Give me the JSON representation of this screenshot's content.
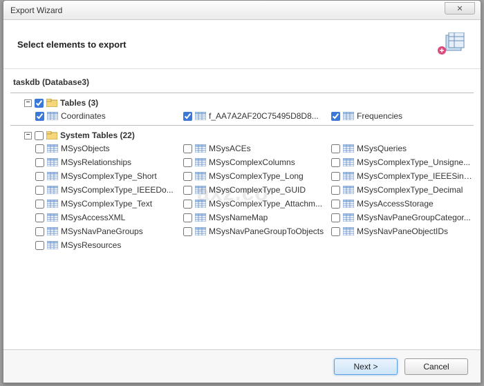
{
  "window": {
    "title": "Export Wizard",
    "close_glyph": "✕"
  },
  "header": {
    "title": "Select elements to export"
  },
  "database": {
    "label": "taskdb (Database3)"
  },
  "tables_group": {
    "toggle": "−",
    "label": "Tables (3)"
  },
  "tables": [
    {
      "label": "Coordinates",
      "checked": true
    },
    {
      "label": "f_AA7A2AF20C75495D8D8...",
      "checked": true
    },
    {
      "label": "Frequencies",
      "checked": true
    }
  ],
  "system_group": {
    "toggle": "−",
    "label": "System Tables (22)"
  },
  "system_tables": [
    {
      "label": "MSysObjects"
    },
    {
      "label": "MSysACEs"
    },
    {
      "label": "MSysQueries"
    },
    {
      "label": "MSysRelationships"
    },
    {
      "label": "MSysComplexColumns"
    },
    {
      "label": "MSysComplexType_Unsigne..."
    },
    {
      "label": "MSysComplexType_Short"
    },
    {
      "label": "MSysComplexType_Long"
    },
    {
      "label": "MSysComplexType_IEEESingle"
    },
    {
      "label": "MSysComplexType_IEEEDo..."
    },
    {
      "label": "MSysComplexType_GUID"
    },
    {
      "label": "MSysComplexType_Decimal"
    },
    {
      "label": "MSysComplexType_Text"
    },
    {
      "label": "MSysComplexType_Attachm..."
    },
    {
      "label": "MSysAccessStorage"
    },
    {
      "label": "MSysAccessXML"
    },
    {
      "label": "MSysNameMap"
    },
    {
      "label": "MSysNavPaneGroupCategor..."
    },
    {
      "label": "MSysNavPaneGroups"
    },
    {
      "label": "MSysNavPaneGroupToObjects"
    },
    {
      "label": "MSysNavPaneObjectIDs"
    },
    {
      "label": "MSysResources"
    }
  ],
  "footer": {
    "next": "Next >",
    "cancel": "Cancel"
  },
  "watermark": "axz.co"
}
